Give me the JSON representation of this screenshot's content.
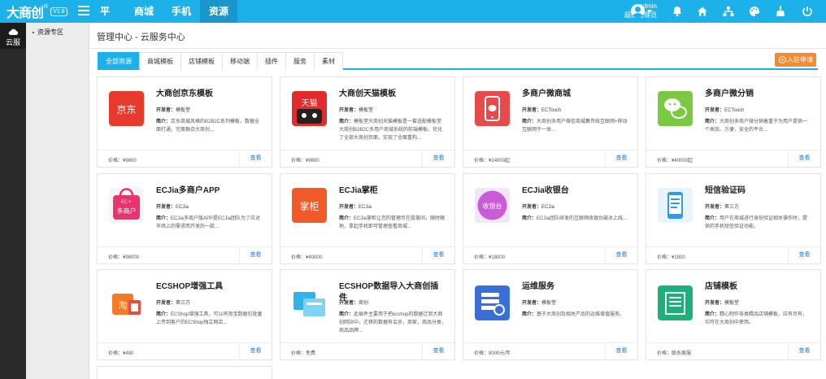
{
  "app": {
    "logo_text": "大商创",
    "logo_reg": "®",
    "logo_version": "V1.8"
  },
  "nav": {
    "items": [
      {
        "label": "平台"
      },
      {
        "label": "商城"
      },
      {
        "label": "手机"
      },
      {
        "label": "资源"
      }
    ],
    "active": "资源"
  },
  "user": {
    "name": "admin",
    "role": "超级管理员"
  },
  "sidebar": {
    "item_label": "云服",
    "sub_item_label": "资源专区"
  },
  "breadcrumb": {
    "text": "管理中心 - 云服务中心"
  },
  "tabs": {
    "items": [
      {
        "label": "全部资源"
      },
      {
        "label": "商城模板"
      },
      {
        "label": "店铺模板"
      },
      {
        "label": "移动端"
      },
      {
        "label": "插件"
      },
      {
        "label": "服务"
      },
      {
        "label": "素材"
      }
    ],
    "active": "全部资源",
    "apply_label": "入驻申请"
  },
  "labels": {
    "dev_prefix": "开发者：",
    "desc_prefix": "简介：",
    "price_prefix": "价格：",
    "view": "查看"
  },
  "cards": [
    {
      "title": "大商创京东模板",
      "developer": "模板堂",
      "desc": "京东商城风格的B2B2C系列模板，数据全面打通，完美融合大商创...",
      "price": "¥9800",
      "icon": "jd-logo-icon",
      "icon_text": "京东",
      "color": "#e8392d"
    },
    {
      "title": "大商创天猫模板",
      "developer": "模板堂",
      "desc": "模板堂大商创天猫模板是一套适配模板堂大商创B2B2C多用户商城系统的前端模板，优化了全部大商创页面，实现了全面重构...",
      "price": "¥9800",
      "icon": "tmall-logo-icon",
      "icon_text": "天猫",
      "color": "#e42b2b"
    },
    {
      "title": "多商户微商城",
      "developer": "ECTouch",
      "desc": "大商创多用户微信商城集传统互联网+移动互联网于一体...",
      "price": "¥24000起",
      "icon": "mobile-shop-icon",
      "icon_text": "",
      "color": "#e74a4a"
    },
    {
      "title": "多商户微分销",
      "developer": "ECTouch",
      "desc": "大商创多商户微分销着重于为用户提供一个高效、方便、安全的平台...",
      "price": "¥40000起",
      "icon": "wechat-distribution-icon",
      "icon_text": "",
      "color": "#7ac943"
    },
    {
      "title": "ECJia多商户APP",
      "developer": "ECJia",
      "desc": "ECJia多商户版APP是ECJia团队为了应对市场上的需求而开发的一款...",
      "price": "¥98000",
      "icon": "ecjia-app-icon",
      "icon_text": "多商户",
      "color": "#e8336f"
    },
    {
      "title": "ECJia掌柜",
      "developer": "ECJia",
      "desc": "ECJia掌柜让您的管理尽在股掌间，随时随地，拿起手机即可管理查看商城...",
      "price": "¥40000",
      "icon": "ecjia-manager-icon",
      "icon_text": "掌柜",
      "color": "#f05a28"
    },
    {
      "title": "ECJia收银台",
      "developer": "ECJia",
      "desc": "ECJia团队研发的互联网收银台破冰上线...",
      "price": "¥18000",
      "icon": "ecjia-cashier-icon",
      "icon_text": "收银台",
      "color": "#c95bd6"
    },
    {
      "title": "短信验证码",
      "developer": "第三方",
      "desc": "用户在商城进行身份验证相关操作时，提供的手机短信验证功能。",
      "price": "¥1500",
      "icon": "sms-icon",
      "icon_text": "",
      "color": "#2e9be6"
    },
    {
      "title": "ECSHOP增强工具",
      "developer": "第三方",
      "desc": "ECShop增强工具，可以将淘宝数据包批量上传到客户的ECShop独立网店...",
      "price": "¥480",
      "icon": "taobao-tool-icon",
      "icon_text": "淘",
      "color": "#f47a24"
    },
    {
      "title": "ECSHOP数据导入大商创插件",
      "developer": "商创",
      "desc": "此插件主要用于把ecshop的数据迁到大商创网站中，迁移的数据有会员，商家，商品分类，商品品牌...",
      "price": "免费",
      "icon": "data-import-icon",
      "icon_text": "",
      "color": "#2fb3e8"
    },
    {
      "title": "运维服务",
      "developer": "模板堂",
      "desc": "基于大商创及相关产品的运维增值服务。",
      "price": "8000元/年",
      "icon": "ops-service-icon",
      "icon_text": "",
      "color": "#3a6fd8"
    },
    {
      "title": "店铺模板",
      "developer": "模板堂",
      "desc": "精心制作各类精品店铺模板，应有尽有，均可在大商创中使用。",
      "price": "联系客服",
      "icon": "store-template-icon",
      "icon_text": "",
      "color": "#1bb27a"
    }
  ]
}
